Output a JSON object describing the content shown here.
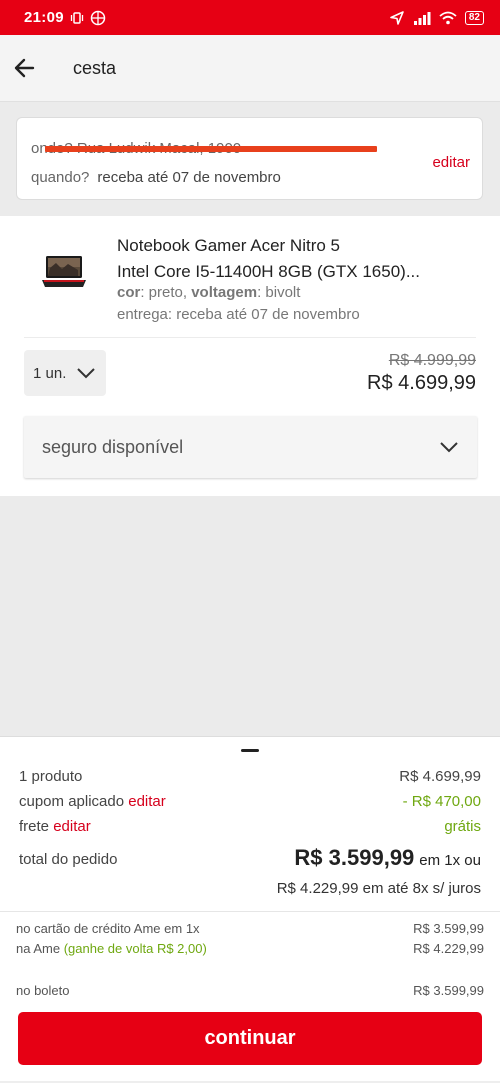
{
  "status_bar": {
    "time": "21:09",
    "battery": "82",
    "icons": [
      "vibrate-icon",
      "app-icon",
      "location-icon",
      "signal-icon",
      "wifi-icon",
      "battery-icon"
    ]
  },
  "app_bar": {
    "title": "cesta",
    "back_icon": "arrow-left-icon"
  },
  "address": {
    "line1": "onde? Rua Ludwik Macal, 1900",
    "when_label": "quando?",
    "when_value": "receba até 07 de novembro",
    "edit_label": "editar"
  },
  "product": {
    "name_line1": "Notebook Gamer Acer Nitro 5",
    "name_line2": "Intel Core I5-11400H 8GB (GTX 1650)...",
    "attr_color_label": "cor",
    "attr_color_value": ": preto, ",
    "attr_voltage_label": "voltagem",
    "attr_voltage_value": ": bivolt",
    "delivery": "entrega: receba até 07 de novembro",
    "quantity": "1 un.",
    "price_old": "R$ 4.999,99",
    "price_new": "R$ 4.699,99",
    "insurance_label": "seguro disponível"
  },
  "summary": {
    "products_label": "1 produto",
    "products_value": "R$ 4.699,99",
    "coupon_label": "cupom aplicado",
    "coupon_edit": "editar",
    "coupon_value": "- R$ 470,00",
    "shipping_label": "frete",
    "shipping_edit": "editar",
    "shipping_value": "grátis",
    "total_label": "total do pedido",
    "total_value": "R$ 3.599,99",
    "total_suffix": "em 1x ou",
    "installments": "R$ 4.229,99 em até 8x s/ juros",
    "payments": {
      "ame_card_label": "no cartão de crédito Ame em 1x",
      "ame_card_value": "R$ 3.599,99",
      "ame_label": "na Ame",
      "ame_cashback": "(ganhe de volta R$ 2,00)",
      "ame_value": "R$ 4.229,99",
      "boleto_label": "no boleto",
      "boleto_value": "R$ 3.599,99"
    },
    "continue_label": "continuar"
  },
  "colors": {
    "brand_red": "#e60014",
    "green": "#6fa811",
    "strike_orange": "#e8401c"
  }
}
